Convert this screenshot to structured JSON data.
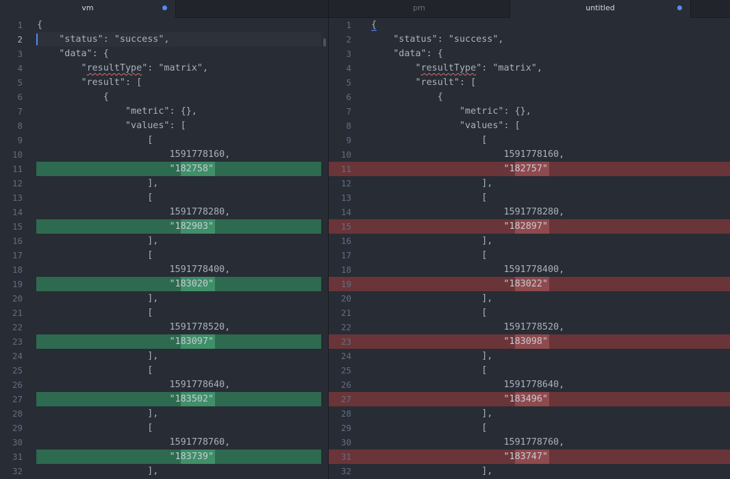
{
  "tabs": {
    "left": [
      {
        "label": "vm",
        "modified": true,
        "active": true
      }
    ],
    "right": [
      {
        "label": "pm",
        "modified": false,
        "active": false
      },
      {
        "label": "untitled",
        "modified": true,
        "active": true
      }
    ]
  },
  "colors": {
    "added_line": "#2e6a4f",
    "added_word": "#3f8f69",
    "removed_line": "#6a3539",
    "removed_word": "#8f4a4e",
    "modified_dot": "#568af2"
  },
  "editor": {
    "line_numbers": [
      "1",
      "2",
      "3",
      "4",
      "5",
      "6",
      "7",
      "8",
      "9",
      "10",
      "11",
      "12",
      "13",
      "14",
      "15",
      "16",
      "17",
      "18",
      "19",
      "20",
      "21",
      "22",
      "23",
      "24",
      "25",
      "26",
      "27",
      "28",
      "29",
      "30",
      "31",
      "32"
    ],
    "left_lines": [
      "{",
      "    \"status\": \"success\",",
      "    \"data\": {",
      "        \"resultType\": \"matrix\",",
      "        \"result\": [",
      "            {",
      "                \"metric\": {},",
      "                \"values\": [",
      "                    [",
      "                        1591778160,",
      "                        \"182758\"",
      "                    ],",
      "                    [",
      "                        1591778280,",
      "                        \"182903\"",
      "                    ],",
      "                    [",
      "                        1591778400,",
      "                        \"183020\"",
      "                    ],",
      "                    [",
      "                        1591778520,",
      "                        \"183097\"",
      "                    ],",
      "                    [",
      "                        1591778640,",
      "                        \"183502\"",
      "                    ],",
      "                    [",
      "                        1591778760,",
      "                        \"183739\"",
      "                    ],"
    ],
    "right_lines": [
      "{",
      "    \"status\": \"success\",",
      "    \"data\": {",
      "        \"resultType\": \"matrix\",",
      "        \"result\": [",
      "            {",
      "                \"metric\": {},",
      "                \"values\": [",
      "                    [",
      "                        1591778160,",
      "                        \"182757\"",
      "                    ],",
      "                    [",
      "                        1591778280,",
      "                        \"182897\"",
      "                    ],",
      "                    [",
      "                        1591778400,",
      "                        \"183022\"",
      "                    ],",
      "                    [",
      "                        1591778520,",
      "                        \"183098\"",
      "                    ],",
      "                    [",
      "                        1591778640,",
      "                        \"183496\"",
      "                    ],",
      "                    [",
      "                        1591778760,",
      "                        \"183747\"",
      "                    ],"
    ],
    "diff_line_numbers": [
      11,
      15,
      19,
      23,
      27,
      31
    ],
    "current_line": 2
  }
}
